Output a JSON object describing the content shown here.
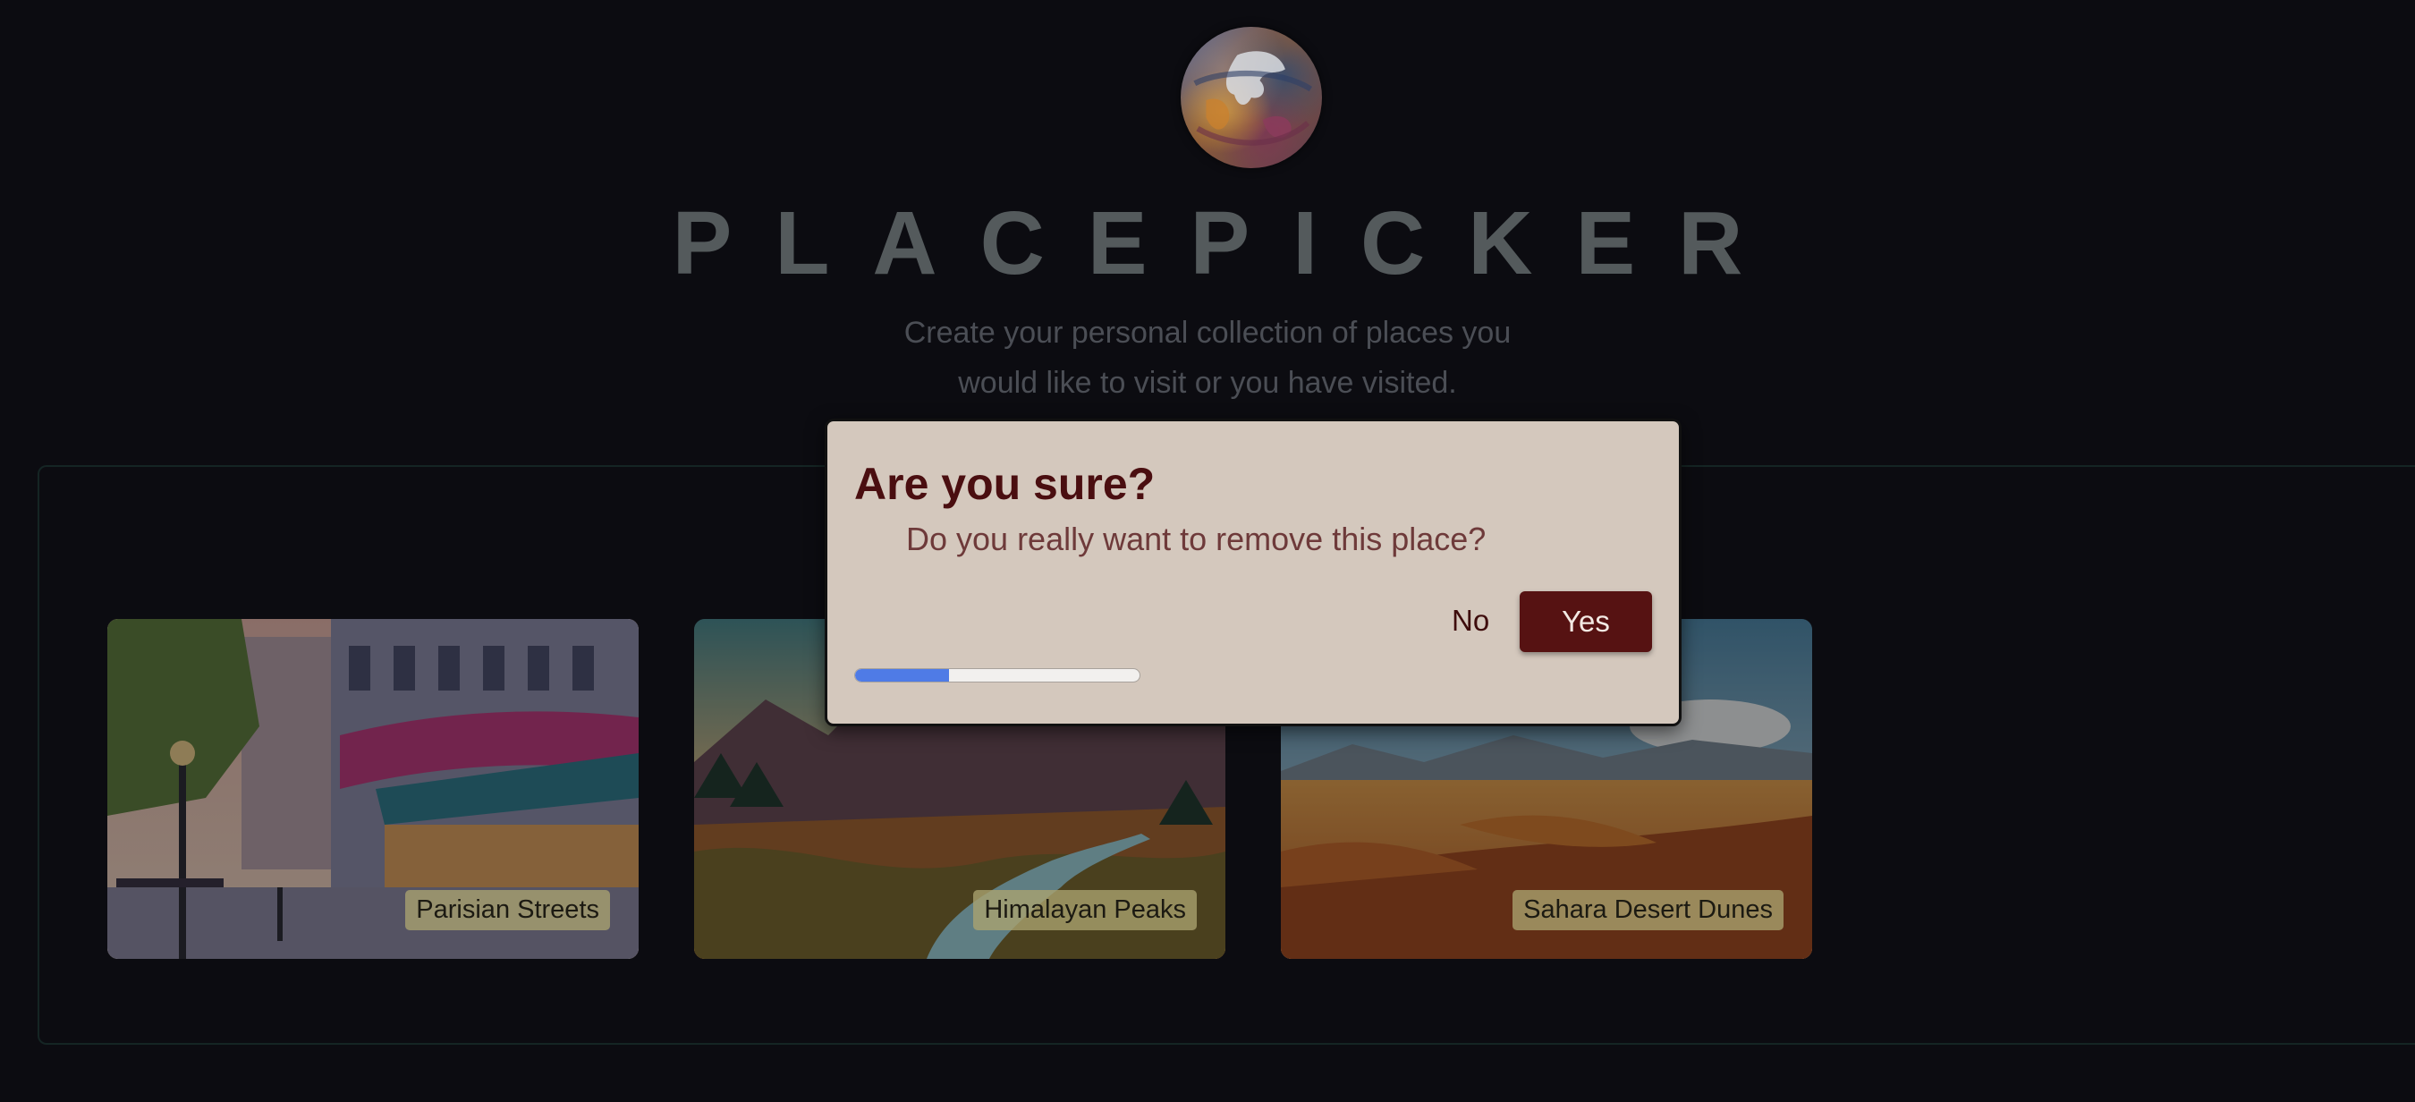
{
  "header": {
    "logo_icon": "globe-icon",
    "title": "PLACEPICKER",
    "subtitle_line1": "Create your personal collection of places you",
    "subtitle_line2": "would like to visit or you have visited."
  },
  "places": [
    {
      "title": "Parisian Streets",
      "image": "parisian-streets-image"
    },
    {
      "title": "Himalayan Peaks",
      "image": "himalayan-peaks-image"
    },
    {
      "title": "Sahara Desert Dunes",
      "image": "sahara-desert-dunes-image"
    }
  ],
  "modal": {
    "title": "Are you sure?",
    "message": "Do you really want to remove this place?",
    "no_label": "No",
    "yes_label": "Yes",
    "progress_fraction": 0.33
  },
  "colors": {
    "background": "#0c0c11",
    "modal_background": "#d4c8bd",
    "modal_title": "#4a0e10",
    "yes_button": "#561212",
    "progress": "#4f7be6",
    "title_text": "#545a5c"
  }
}
